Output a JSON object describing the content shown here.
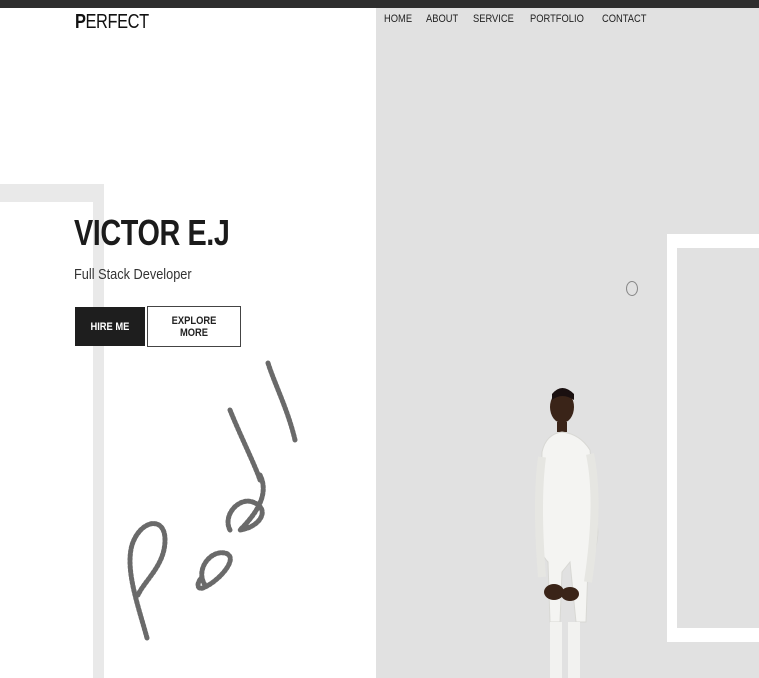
{
  "header": {
    "logo_initial": "P",
    "logo_rest": "ERFECT",
    "nav": [
      {
        "label": "HOME"
      },
      {
        "label": "ABOUT"
      },
      {
        "label": "SERVICE"
      },
      {
        "label": "PORTFOLIO"
      },
      {
        "label": "CONTACT"
      }
    ]
  },
  "hero": {
    "name": "VICTOR E.J",
    "role": "Full Stack Developer",
    "hire_label": "HIRE ME",
    "explore_label": "EXPLORE MORE"
  },
  "colors": {
    "right_panel": "#e1e1e1",
    "primary_button": "#1e1e1e",
    "topbar": "#2e2e2e"
  },
  "icons": [
    "signature-image",
    "profile-photo",
    "cursor-ring-icon"
  ]
}
